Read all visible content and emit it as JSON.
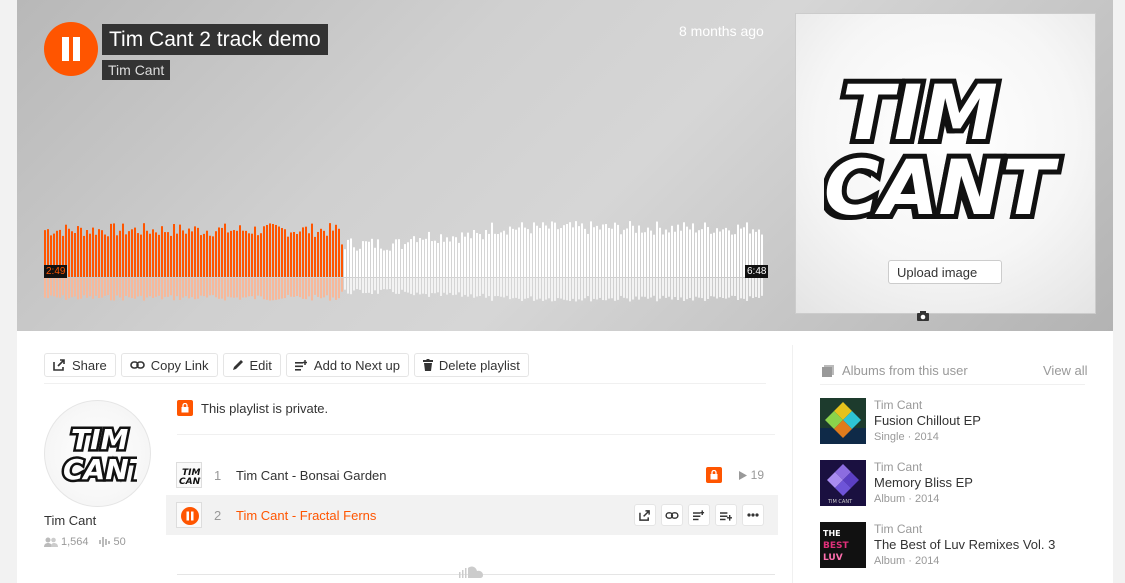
{
  "playlist": {
    "title": "Tim Cant 2 track demo",
    "artist": "Tim Cant",
    "posted": "8 months ago",
    "time_current": "2:49",
    "time_total": "6:48",
    "progress": 0.415,
    "upload_image_label": "Upload image"
  },
  "colors": {
    "accent": "#ff5500",
    "played_bar": "#ff5500",
    "unplayed_bar": "#ffffff"
  },
  "actions": [
    {
      "label": "Share",
      "icon": "share-icon"
    },
    {
      "label": "Copy Link",
      "icon": "link-icon"
    },
    {
      "label": "Edit",
      "icon": "pencil-icon"
    },
    {
      "label": "Add to Next up",
      "icon": "add-to-queue-icon"
    },
    {
      "label": "Delete playlist",
      "icon": "trash-icon"
    }
  ],
  "user": {
    "name": "Tim Cant",
    "followers": "1,564",
    "tracks": "50"
  },
  "private_notice": "This playlist is private.",
  "tracks": [
    {
      "num": "1",
      "title": "Tim Cant - Bonsai Garden",
      "plays": "19",
      "private": true
    },
    {
      "num": "2",
      "title": "Tim Cant - Fractal Ferns",
      "playing": true
    }
  ],
  "sidebar": {
    "header": "Albums from this user",
    "view_all": "View all",
    "albums": [
      {
        "artist": "Tim Cant",
        "title": "Fusion Chillout EP",
        "meta": "Single · 2014"
      },
      {
        "artist": "Tim Cant",
        "title": "Memory Bliss EP",
        "meta": "Album · 2014"
      },
      {
        "artist": "Tim Cant",
        "title": "The Best of Luv Remixes Vol. 3",
        "meta": "Album · 2014"
      }
    ]
  }
}
